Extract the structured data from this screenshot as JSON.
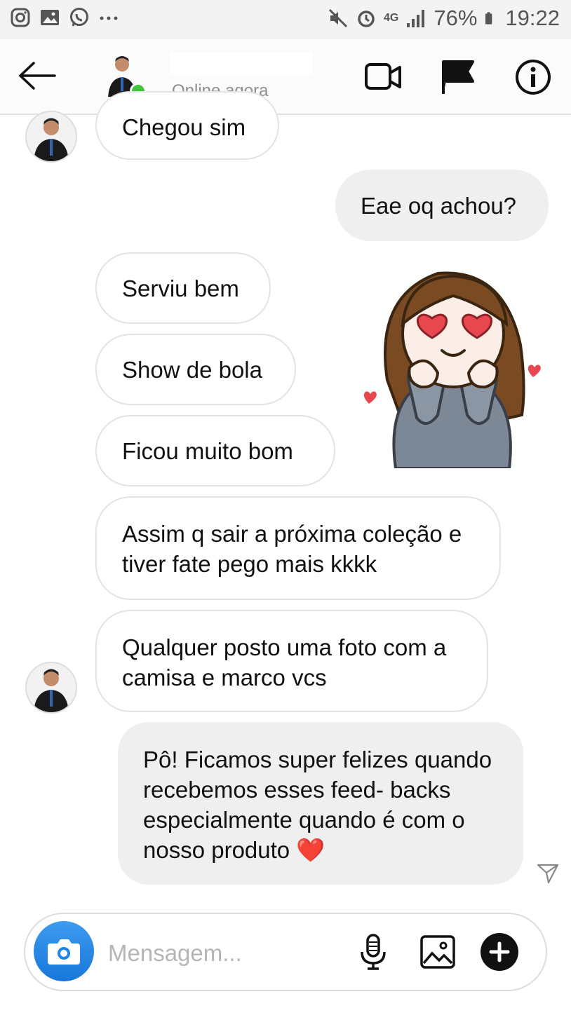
{
  "status_bar": {
    "battery": "76%",
    "time": "19:22",
    "network": "4G",
    "icons": [
      "instagram-icon",
      "gallery-icon",
      "whatsapp-icon",
      "more-icon",
      "mute-icon",
      "alarm-icon",
      "signal-icon",
      "battery-icon"
    ]
  },
  "header": {
    "status": "Online agora",
    "icons": [
      "back-arrow-icon",
      "video-call-icon",
      "flag-icon",
      "info-icon"
    ]
  },
  "messages": [
    {
      "from": "them",
      "text": "Chegou sim"
    },
    {
      "from": "me",
      "text": "Eae oq achou?"
    },
    {
      "from": "them",
      "text": "Serviu bem"
    },
    {
      "from": "them",
      "text": "Show de bola"
    },
    {
      "from": "them",
      "text": "Ficou muito bom"
    },
    {
      "from": "them",
      "text": "Assim q sair a próxima coleção e tiver fate pego mais kkkk"
    },
    {
      "from": "them",
      "text": "Qualquer posto uma foto com a camisa e marco vcs"
    },
    {
      "from": "me",
      "text": "Pô! Ficamos super felizes quando recebemos esses feed- backs especialmente quando é com o nosso produto ❤️"
    }
  ],
  "sticker": {
    "name": "girl-heart-eyes-sticker"
  },
  "composer": {
    "placeholder": "Mensagem...",
    "icons": [
      "camera-icon",
      "microphone-icon",
      "gallery-icon",
      "plus-icon"
    ]
  },
  "colors": {
    "online": "#3dc63d",
    "camera_button": "#1f86e5",
    "incoming_bubble_border": "#e3e3e3",
    "outgoing_bubble": "#efefef",
    "heart": "#e8474f"
  }
}
